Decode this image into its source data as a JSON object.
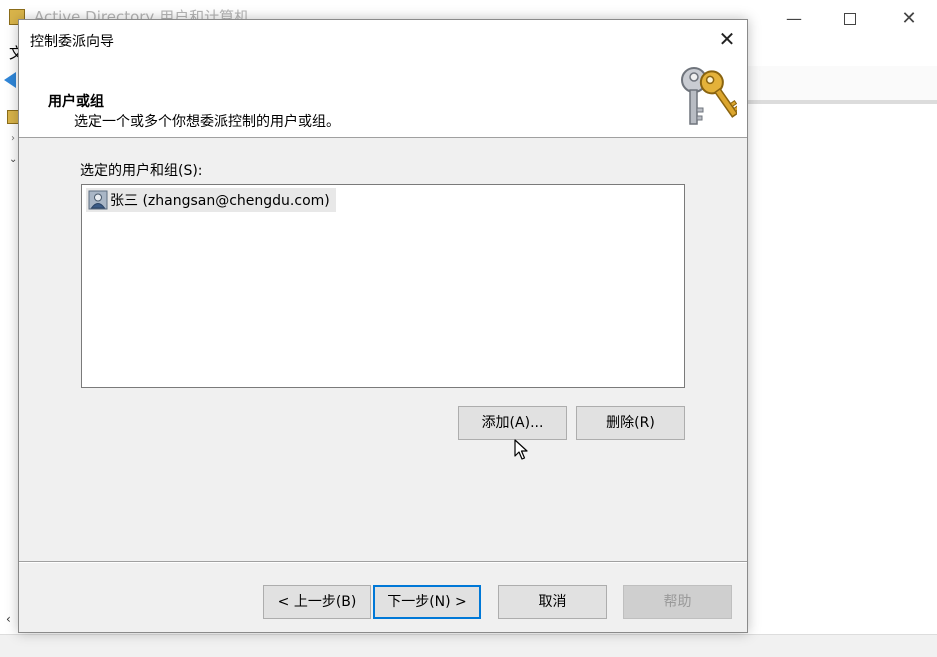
{
  "background_window": {
    "title": "Active Directory 用户和计算机",
    "menu_fragment": "文"
  },
  "dialog": {
    "title": "控制委派向导",
    "header": {
      "title": "用户或组",
      "subtitle": "选定一个或多个你想委派控制的用户或组。",
      "icon": "keys-icon"
    },
    "list_label": "选定的用户和组(S):",
    "items": [
      {
        "label": "张三 (zhangsan@chengdu.com)",
        "icon": "user-icon"
      }
    ],
    "buttons": {
      "add": "添加(A)...",
      "remove": "删除(R)",
      "back": "< 上一步(B)",
      "next": "下一步(N) >",
      "cancel": "取消",
      "help": "帮助"
    }
  },
  "colors": {
    "dialog_bg": "#f0f0f0",
    "default_button_border": "#0078d7",
    "disabled_text": "#9a9a9a"
  }
}
